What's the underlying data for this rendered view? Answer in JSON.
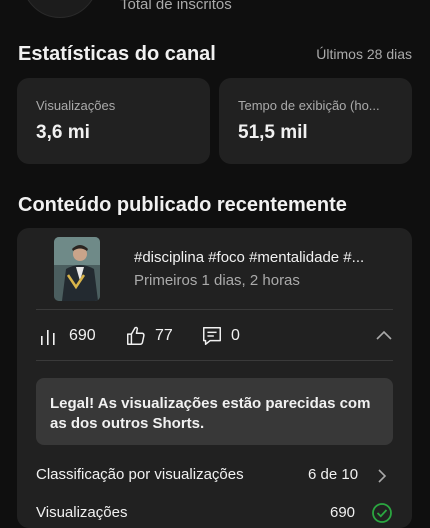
{
  "header": {
    "subscribers_label": "Total de inscritos"
  },
  "stats": {
    "title": "Estatísticas do canal",
    "period": "Últimos 28 dias",
    "cards": [
      {
        "label": "Visualizações",
        "value": "3,6 mi"
      },
      {
        "label": "Tempo de exibição (ho...",
        "value": "51,5 mil"
      }
    ]
  },
  "recent": {
    "title": "Conteúdo publicado recentemente",
    "video": {
      "title": "#disciplina #foco #mentalidade #...",
      "age": "Primeiros 1 dias, 2 horas",
      "views": "690",
      "likes": "77",
      "comments": "0"
    },
    "insight": "Legal! As visualizações estão parecidas com as dos outros Shorts.",
    "ranking": {
      "label": "Classificação por visualizações",
      "value": "6 de 10"
    },
    "views_row": {
      "label": "Visualizações",
      "value": "690"
    }
  },
  "colors": {
    "background": "#0f0f0f",
    "card": "#212121",
    "insight_bg": "#383838",
    "success": "#2ba640"
  },
  "icons": [
    "bar-chart-icon",
    "thumb-up-icon",
    "comment-icon",
    "chevron-up-icon",
    "chevron-right-icon",
    "check-circle-icon"
  ]
}
